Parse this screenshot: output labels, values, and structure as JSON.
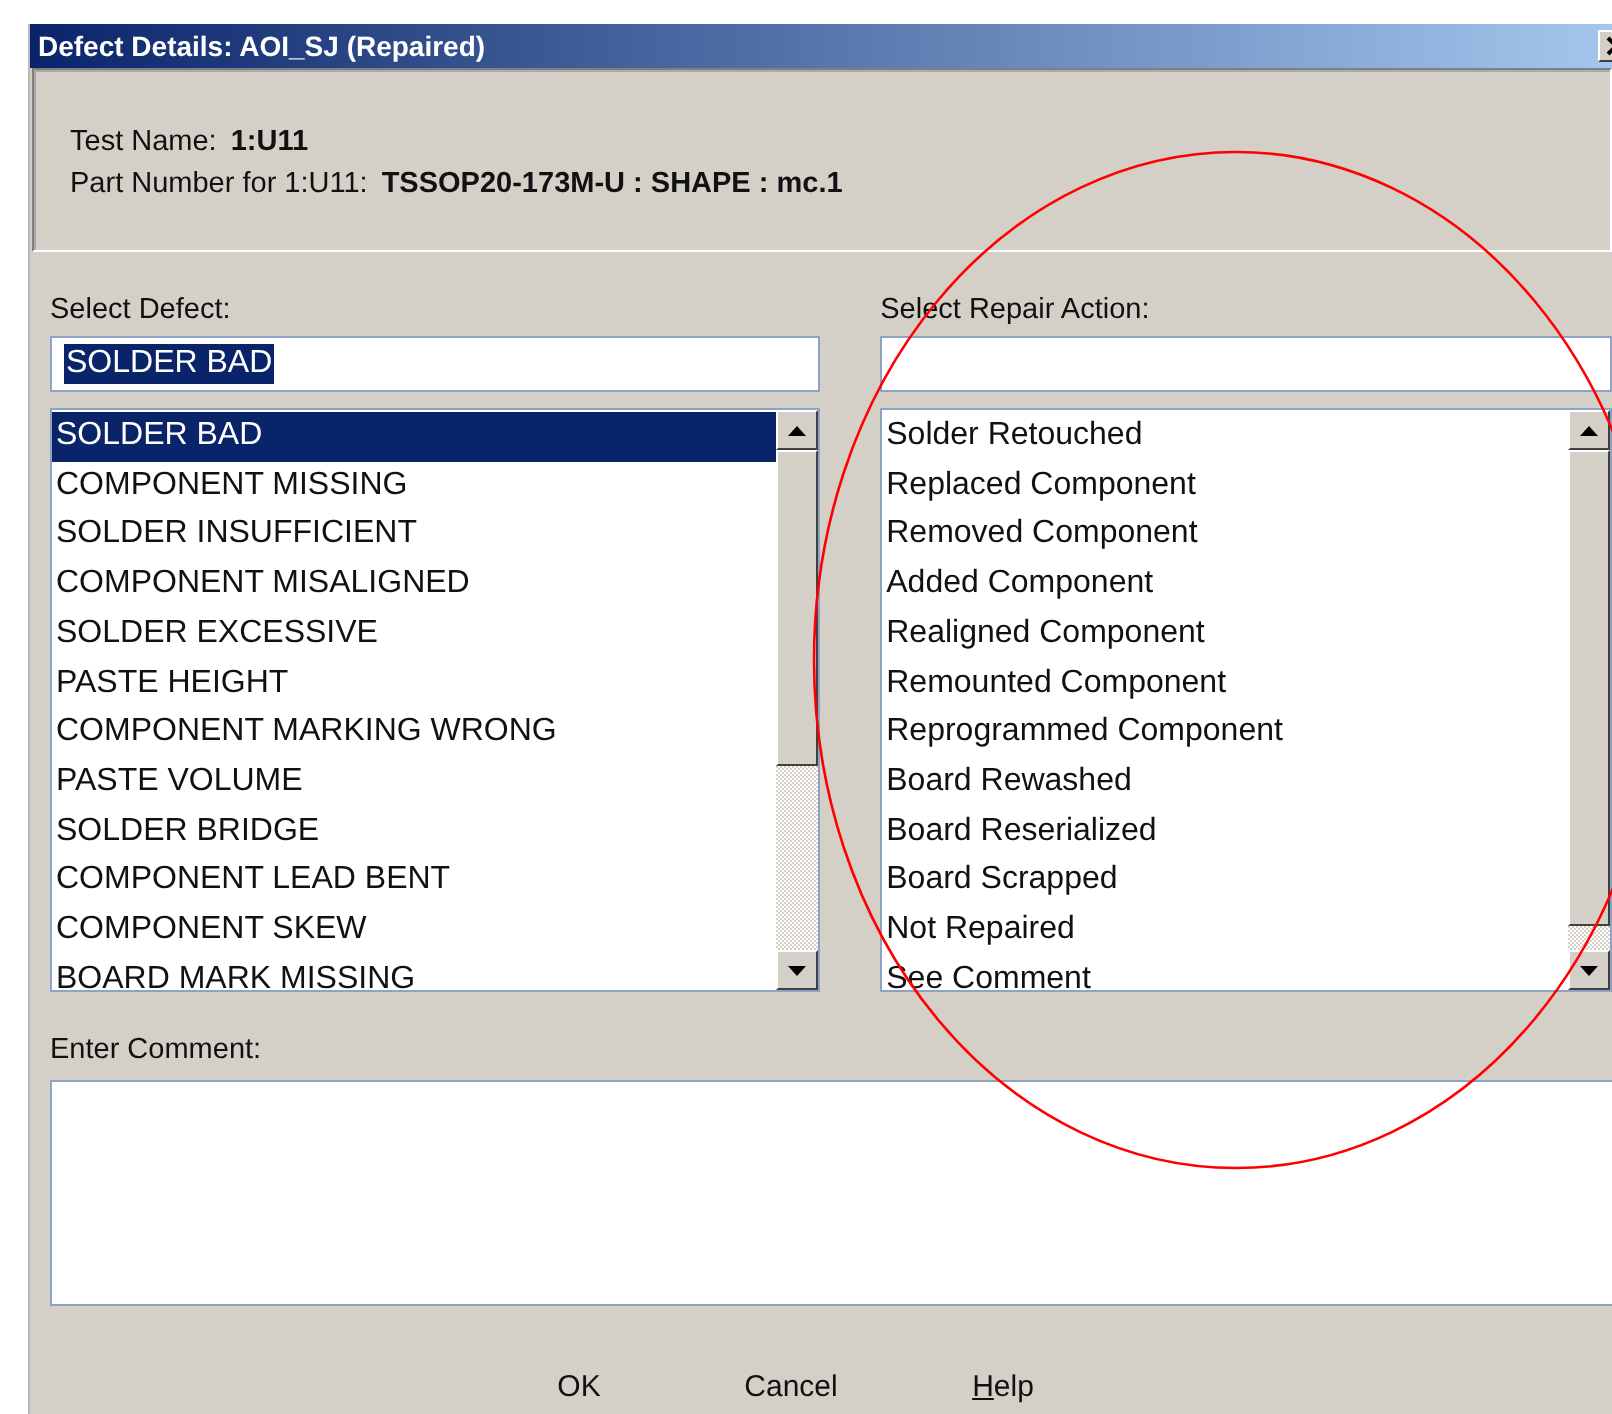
{
  "window": {
    "title": "Defect Details: AOI_SJ (Repaired)"
  },
  "info": {
    "test_name_label": "Test Name:",
    "test_name": "1:U11",
    "part_label": "Part Number for 1:U11:",
    "part_number": "TSSOP20-173M-U : SHAPE : mc.1"
  },
  "defect": {
    "label": "Select Defect:",
    "value": "SOLDER BAD",
    "value_selected": true,
    "items": [
      {
        "label": "SOLDER BAD",
        "selected": true
      },
      {
        "label": "COMPONENT MISSING",
        "selected": false
      },
      {
        "label": "SOLDER INSUFFICIENT",
        "selected": false
      },
      {
        "label": "COMPONENT MISALIGNED",
        "selected": false
      },
      {
        "label": "SOLDER EXCESSIVE",
        "selected": false
      },
      {
        "label": "PASTE HEIGHT",
        "selected": false
      },
      {
        "label": "COMPONENT MARKING WRONG",
        "selected": false
      },
      {
        "label": "PASTE VOLUME",
        "selected": false
      },
      {
        "label": "SOLDER BRIDGE",
        "selected": false
      },
      {
        "label": "COMPONENT LEAD BENT",
        "selected": false
      },
      {
        "label": "COMPONENT SKEW",
        "selected": false
      },
      {
        "label": "BOARD MARK MISSING",
        "selected": false
      }
    ]
  },
  "repair": {
    "label": "Select Repair Action:",
    "items": [
      {
        "label": "Solder Retouched",
        "selected": false
      },
      {
        "label": "Replaced Component",
        "selected": false
      },
      {
        "label": "Removed Component",
        "selected": false
      },
      {
        "label": "Added Component",
        "selected": false
      },
      {
        "label": "Realigned Component",
        "selected": false
      },
      {
        "label": "Remounted Component",
        "selected": false
      },
      {
        "label": "Reprogrammed Component",
        "selected": false
      },
      {
        "label": "Board Rewashed",
        "selected": false
      },
      {
        "label": "Board Reserialized",
        "selected": false
      },
      {
        "label": "Board Scrapped",
        "selected": false
      },
      {
        "label": "Not Repaired",
        "selected": false
      },
      {
        "label": "See Comment",
        "selected": false
      }
    ]
  },
  "comment": {
    "label": "Enter Comment:"
  },
  "buttons": [
    {
      "label": "OK",
      "mnemonic_underlined": false
    },
    {
      "label": "Cancel",
      "mnemonic_underlined": false
    },
    {
      "label": "Help",
      "mnemonic_underlined": true
    }
  ]
}
